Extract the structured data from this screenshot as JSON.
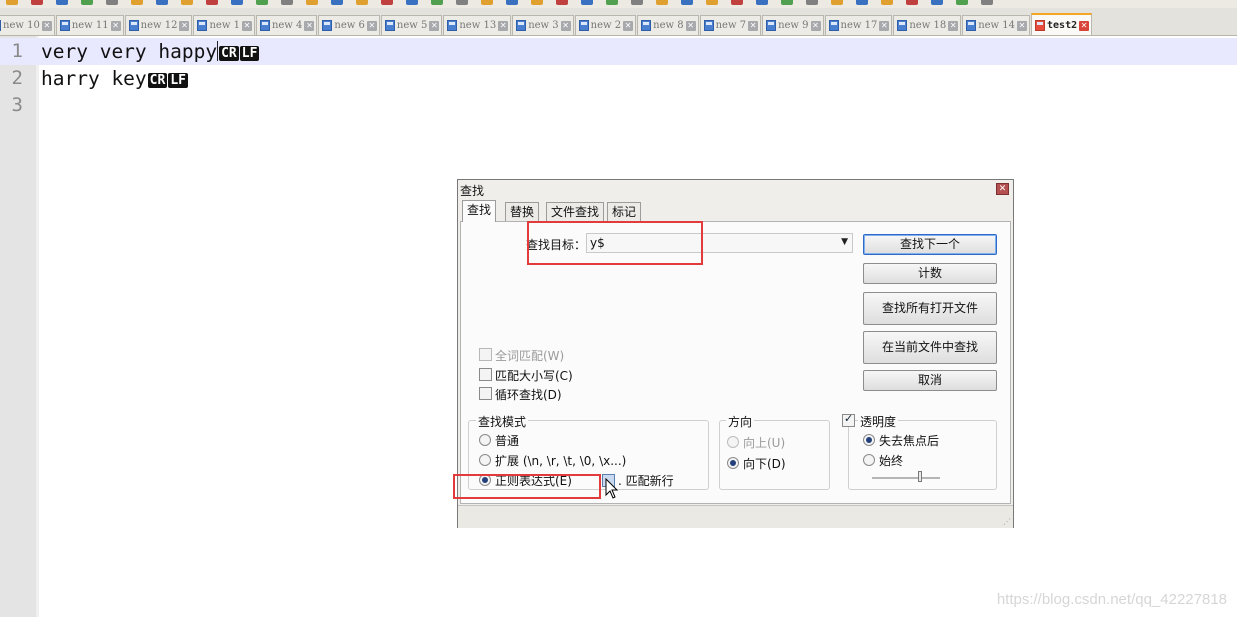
{
  "toolbar": {
    "icon_colors": [
      "#e0a030",
      "#c04040",
      "#3a70c0",
      "#50a050",
      "#808080",
      "#e0a030",
      "#3a70c0"
    ]
  },
  "tabs": [
    {
      "label": "new 10"
    },
    {
      "label": "new 11"
    },
    {
      "label": "new 12"
    },
    {
      "label": "new 1"
    },
    {
      "label": "new 4"
    },
    {
      "label": "new 6"
    },
    {
      "label": "new 5"
    },
    {
      "label": "new 13"
    },
    {
      "label": "new 3"
    },
    {
      "label": "new 2"
    },
    {
      "label": "new 8"
    },
    {
      "label": "new 7"
    },
    {
      "label": "new 9"
    },
    {
      "label": "new 17"
    },
    {
      "label": "new 18"
    },
    {
      "label": "new 14"
    },
    {
      "label": "test2",
      "active": true
    }
  ],
  "editor": {
    "lines": [
      {
        "num": "1",
        "text": "very very happy",
        "eol": [
          "CR",
          "LF"
        ],
        "current": true
      },
      {
        "num": "2",
        "text": "harry key",
        "eol": [
          "CR",
          "LF"
        ]
      },
      {
        "num": "3",
        "text": "",
        "eol": []
      }
    ]
  },
  "dialog": {
    "title": "查找",
    "close_glyph": "✕",
    "tabs": [
      "查找",
      "替换",
      "文件查找",
      "标记"
    ],
    "find_label": "查找目标：",
    "find_value": "y$",
    "buttons": {
      "find_next": "查找下一个",
      "count": "计数",
      "find_all_open": "查找所有打开文件",
      "find_in_current": "在当前文件中查找",
      "cancel": "取消"
    },
    "options": {
      "whole_word": "全词匹配(W)",
      "match_case": "匹配大小写(C)",
      "wrap": "循环查找(D)"
    },
    "search_mode": {
      "title": "查找模式",
      "normal": "普通",
      "extended": "扩展 (\\n, \\r, \\t, \\0, \\x...)",
      "regex": "正则表达式(E)",
      "dot_newline": ". 匹配新行"
    },
    "direction": {
      "title": "方向",
      "up": "向上(U)",
      "down": "向下(D)"
    },
    "transparency": {
      "title": "透明度",
      "on_lose_focus": "失去焦点后",
      "always": "始终",
      "level": 0.7
    },
    "grip": "⋰"
  },
  "watermark": "https://blog.csdn.net/qq_42227818"
}
